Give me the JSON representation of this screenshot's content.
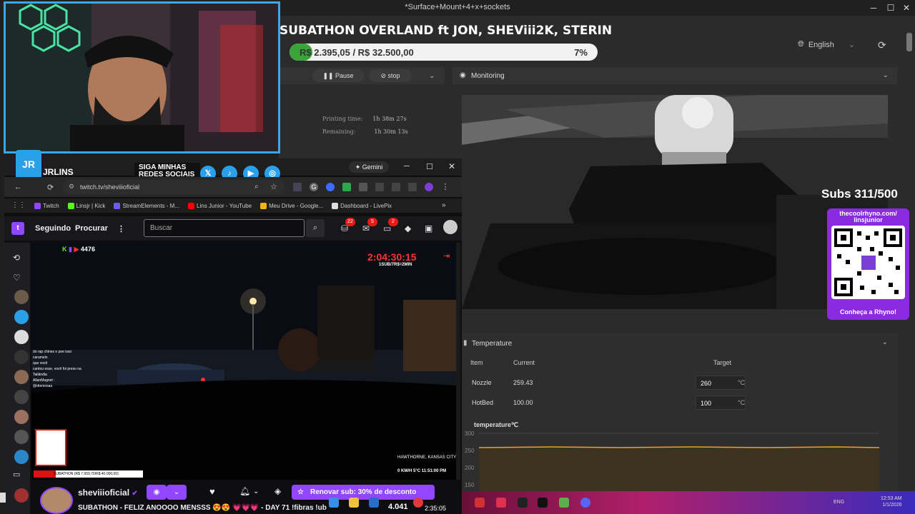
{
  "window": {
    "title": "*Surface+Mount+4+x+sockets",
    "controls": [
      "─",
      "☐",
      "✕"
    ]
  },
  "overlay": {
    "subathon_title": "SUBATHON OVERLAND ft JON, SHEViii2K, STERIN",
    "goal_text": "R$ 2.395,05 / R$ 32.500,00",
    "goal_percent_text": "7%",
    "goal_fraction": 0.074,
    "subs": "Subs 311/500",
    "qr_url": "thecoolrhyno.com/ linsjunior",
    "qr_cta": "Conheça a Rhyno!",
    "banner_name": "JRLINS",
    "banner_cta_1": "SIGA MINHAS",
    "banner_cta_2": "REDES SOCIAIS",
    "social_icons": [
      "x-icon",
      "tiktok-icon",
      "youtube-icon",
      "instagram-icon"
    ]
  },
  "printer": {
    "language": "English",
    "pause_label": "Pause",
    "stop_label": "stop",
    "printing_time_label": "Printing time:",
    "printing_time_value": "1h 38m 27s",
    "remaining_label": "Remaining:",
    "remaining_value": "1h 30m 13s",
    "monitoring_label": "Monitoring",
    "temperature": {
      "title": "Temperature",
      "columns": [
        "Item",
        "Current",
        "Target"
      ],
      "rows": [
        {
          "item": "Nozzle",
          "current": "259.43",
          "target": "260",
          "unit": "°C"
        },
        {
          "item": "HotBed",
          "current": "100.00",
          "target": "100",
          "unit": "°C"
        }
      ],
      "chart_title": "temperature℃",
      "y_ticks": [
        "300",
        "250",
        "200",
        "150"
      ]
    }
  },
  "browser": {
    "gemini_label": "Gemini",
    "url": "twitch.tv/sheviiioficial",
    "bookmarks": [
      {
        "label": "Twitch",
        "color": "#9147ff"
      },
      {
        "label": "Linsjr | Kick",
        "color": "#53fc18"
      },
      {
        "label": "StreamElements - M...",
        "color": "#6b5bff"
      },
      {
        "label": "Lins Junior - YouTube",
        "color": "#ff0000"
      },
      {
        "label": "Meu Drive - Google...",
        "color": "#f4b400"
      },
      {
        "label": "Dashboard - LivePix",
        "color": "#dddddd"
      }
    ],
    "twitch": {
      "following": "Seguindo",
      "browse": "Procurar",
      "search_placeholder": "Buscar",
      "badges": [
        "22",
        "5",
        "2"
      ],
      "viewers": "4476",
      "timer": "2:04:30:15",
      "timer_sub": "1SUB/7R$=2MIN",
      "location": "HAWTHORNE, KANSAS CITY",
      "speed": "0 KM/H",
      "temp": "5°C",
      "clock": "11:51:00 PM",
      "stream_progress": "SUBATHON (R$ 7.959,70/R$ 40.000,00)",
      "stream_progress_fraction": 0.2,
      "chat_lines": [
        "do rap chines e poe isso",
        "caramelo",
        "que você",
        "cantou esse, você foi preso na",
        "Tailândia",
        "AllanMagnet :",
        "@drenisnaa"
      ],
      "channel_name": "sheviiioficial",
      "stream_title": "SUBATHON - FELIZ ANOOOO MENSSS 😍😍 💗💗💗 - DAY 71 !fibras !ub",
      "sub_button": "Renovar sub: 30% de desconto"
    }
  },
  "taskbar": {
    "time": "12:53 AM",
    "date": "1/1/2026",
    "lang": "ENG",
    "overlay_money": "4.041",
    "overlay_clock": "2:35:05"
  }
}
